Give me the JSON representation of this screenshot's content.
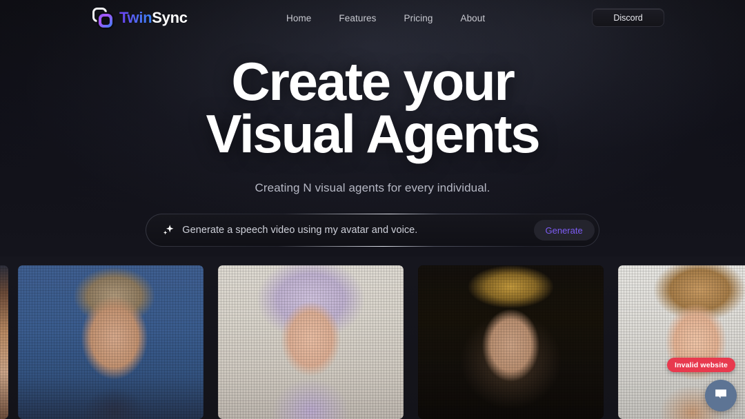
{
  "brand": {
    "logo_icon": "twinsync-logo-icon",
    "name_part_1": "Twin",
    "name_part_2": "Sync",
    "gradient_from": "#6d3ff0",
    "gradient_to": "#3b82f6"
  },
  "nav": {
    "links": [
      {
        "label": "Home"
      },
      {
        "label": "Features"
      },
      {
        "label": "Pricing"
      },
      {
        "label": "About"
      }
    ],
    "cta": {
      "label": "Discord"
    }
  },
  "hero": {
    "headline_line_1": "Create your",
    "headline_line_2": "Visual Agents",
    "subheadline": "Creating N visual agents for every individual."
  },
  "prompt": {
    "sparkle_icon": "sparkle-icon",
    "value": "Generate a speech video using my avatar and voice.",
    "placeholder": "Generate a speech video using my avatar and voice.",
    "button_label": "Generate",
    "button_color": "#7d5cf5"
  },
  "gallery": {
    "cards": [
      {
        "name": "avatar-card-edge-left",
        "alt": "cropped avatar sliver"
      },
      {
        "name": "avatar-card-1",
        "alt": "man with curly hair on blue backdrop"
      },
      {
        "name": "avatar-card-2",
        "alt": "woman with lavender hair in bright room"
      },
      {
        "name": "avatar-card-3",
        "alt": "woman with golden headpiece on dark backdrop"
      },
      {
        "name": "avatar-card-4",
        "alt": "man with beard on light grey backdrop"
      }
    ]
  },
  "overlays": {
    "invalid_badge": {
      "label": "Invalid website",
      "color": "#e8394e"
    },
    "chat_fab": {
      "icon": "chat-bubble-icon",
      "color": "#5d7494"
    }
  }
}
